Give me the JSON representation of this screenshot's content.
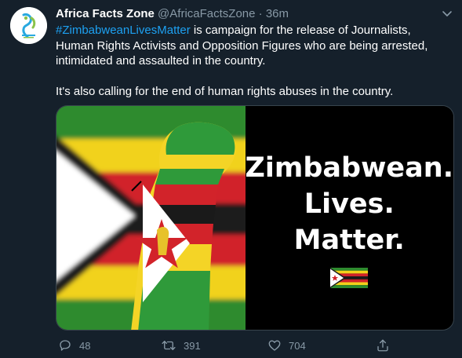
{
  "tweet": {
    "author_name": "Africa Facts Zone",
    "handle": "@AfricaFactsZone",
    "separator": "·",
    "time": "36m",
    "hashtag": "#ZimbabweanLivesMatter",
    "text_line1_rest": " is campaign for the release of Journalists, Human Rights Activists and Opposition Figures who are being arrested, intimidated and assaulted in the country.",
    "text_paragraph2": "It's also calling for the end of human rights abuses in the country.",
    "image_text": {
      "line1": "Zimbabwean.",
      "line2": "Lives.",
      "line3": "Matter."
    }
  },
  "actions": {
    "reply_count": "48",
    "retweet_count": "391",
    "like_count": "704"
  },
  "icons": {
    "reply": "reply-icon",
    "retweet": "retweet-icon",
    "like": "heart-icon",
    "share": "share-icon",
    "menu": "chevron-down-icon"
  },
  "colors": {
    "background": "#15202b",
    "accent": "#1da1f2",
    "secondary_text": "#8899a6",
    "border": "#38444d"
  }
}
